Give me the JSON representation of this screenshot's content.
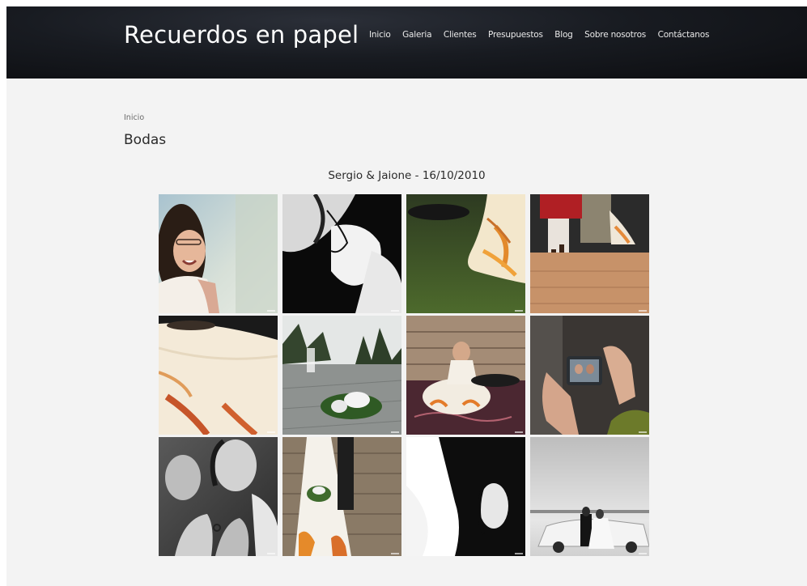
{
  "site": {
    "logo": "Recuerdos en papel"
  },
  "nav": {
    "items": [
      "Inicio",
      "Galeria",
      "Clientes",
      "Presupuestos",
      "Blog",
      "Sobre nosotros",
      "Contáctanos"
    ]
  },
  "breadcrumb": {
    "home": "Inicio"
  },
  "page": {
    "title": "Bodas"
  },
  "album": {
    "title": "Sergio & Jaione - 16/10/2010"
  }
}
